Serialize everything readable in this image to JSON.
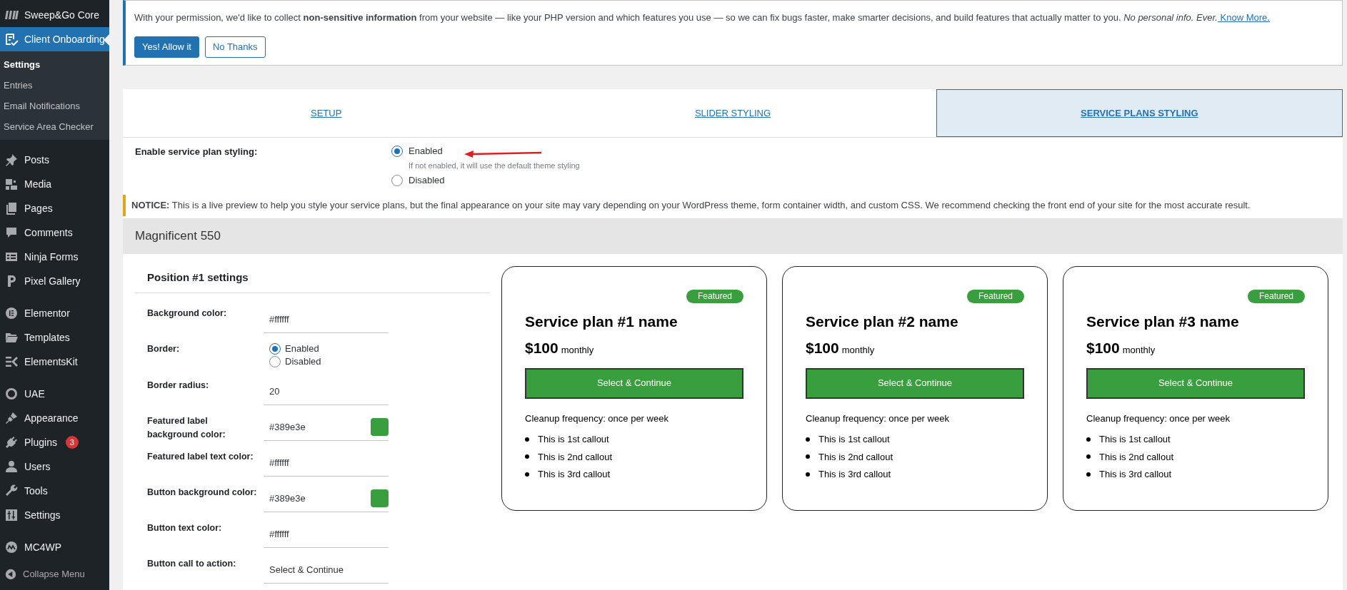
{
  "sidebar": {
    "groups": [
      [
        {
          "label": "Sweep&Go Core",
          "selected": false
        },
        {
          "label": "Client Onboarding",
          "selected": true,
          "children": [
            {
              "label": "Settings",
              "selected": true
            },
            {
              "label": "Entries",
              "selected": false
            },
            {
              "label": "Email Notifications",
              "selected": false
            },
            {
              "label": "Service Area Checker",
              "selected": false
            }
          ]
        }
      ],
      [
        {
          "label": "Posts",
          "selected": false
        },
        {
          "label": "Media",
          "selected": false
        },
        {
          "label": "Pages",
          "selected": false
        },
        {
          "label": "Comments",
          "selected": false
        },
        {
          "label": "Ninja Forms",
          "selected": false
        },
        {
          "label": "Pixel Gallery",
          "selected": false
        }
      ],
      [
        {
          "label": "Elementor",
          "selected": false
        },
        {
          "label": "Templates",
          "selected": false
        },
        {
          "label": "ElementsKit",
          "selected": false
        }
      ],
      [
        {
          "label": "UAE",
          "selected": false
        },
        {
          "label": "Appearance",
          "selected": false
        },
        {
          "label": "Plugins",
          "selected": false,
          "badge": "3"
        },
        {
          "label": "Users",
          "selected": false
        },
        {
          "label": "Tools",
          "selected": false
        },
        {
          "label": "Settings",
          "selected": false
        }
      ],
      [
        {
          "label": "MC4WP",
          "selected": false
        }
      ]
    ],
    "collapse_label": "Collapse Menu"
  },
  "consent_notice": {
    "text": "With your permission, we'd like to collect **non-sensitive information** from your website — like your PHP version and which features you use — so we can fix bugs faster, make smarter decisions, and build features that actually matter to you. *No personal info. Ever.*",
    "link": " Know More.",
    "buttons": [
      {
        "label": "Yes! Allow it",
        "kind": "primary"
      },
      {
        "label": "No Thanks",
        "kind": "secondary"
      }
    ]
  },
  "tabs": [
    {
      "label": "SETUP",
      "selected": false
    },
    {
      "label": "SLIDER STYLING",
      "selected": false
    },
    {
      "label": "SERVICE PLANS STYLING",
      "selected": true
    }
  ],
  "enable_styling": {
    "label": "Enable service plan styling:",
    "options": [
      {
        "label": "Enabled",
        "selected": true,
        "hint": "If not enabled, it will use the default theme styling"
      },
      {
        "label": "Disabled",
        "selected": false
      }
    ]
  },
  "preview_notice": "**NOTICE:** This is a live preview to help you style your service plans, but the final appearance on your site may vary depending on your WordPress theme, form container width, and custom CSS. We recommend checking the front end of your site for the most accurate result.",
  "section_title": "Magnificent 550",
  "settings": {
    "title": "Position #1 settings",
    "fields": [
      {
        "label": "Background color:",
        "kind": "text",
        "value": "#ffffff"
      },
      {
        "label": "Border:",
        "kind": "radio",
        "options": [
          {
            "label": "Enabled",
            "selected": true
          },
          {
            "label": "Disabled",
            "selected": false
          }
        ]
      },
      {
        "label": "Border radius:",
        "kind": "text",
        "value": "20"
      },
      {
        "label": "Featured label background color:",
        "kind": "color",
        "value": "#389e3e",
        "color": "#389e3e"
      },
      {
        "label": "Featured label text color:",
        "kind": "text",
        "value": "#ffffff"
      },
      {
        "label": "Button background color:",
        "kind": "color",
        "value": "#389e3e",
        "color": "#389e3e"
      },
      {
        "label": "Button text color:",
        "kind": "text",
        "value": "#ffffff"
      },
      {
        "label": "Button call to action:",
        "kind": "text",
        "value": "Select & Continue"
      }
    ]
  },
  "plans": [
    {
      "badge": "Featured",
      "name": "Service plan #1 name",
      "price": "$100",
      "period": "monthly",
      "button": "Select & Continue",
      "frequency": "Cleanup frequency: once per week",
      "callouts": [
        "This is 1st callout",
        "This is 2nd callout",
        "This is 3rd callout"
      ]
    },
    {
      "badge": "Featured",
      "name": "Service plan #2 name",
      "price": "$100",
      "period": "monthly",
      "button": "Select & Continue",
      "frequency": "Cleanup frequency: once per week",
      "callouts": [
        "This is 1st callout",
        "This is 2nd callout",
        "This is 3rd callout"
      ]
    },
    {
      "badge": "Featured",
      "name": "Service plan #3 name",
      "price": "$100",
      "period": "monthly",
      "button": "Select & Continue",
      "frequency": "Cleanup frequency: once per week",
      "callouts": [
        "This is 1st callout",
        "This is 2nd callout",
        "This is 3rd callout"
      ]
    }
  ]
}
